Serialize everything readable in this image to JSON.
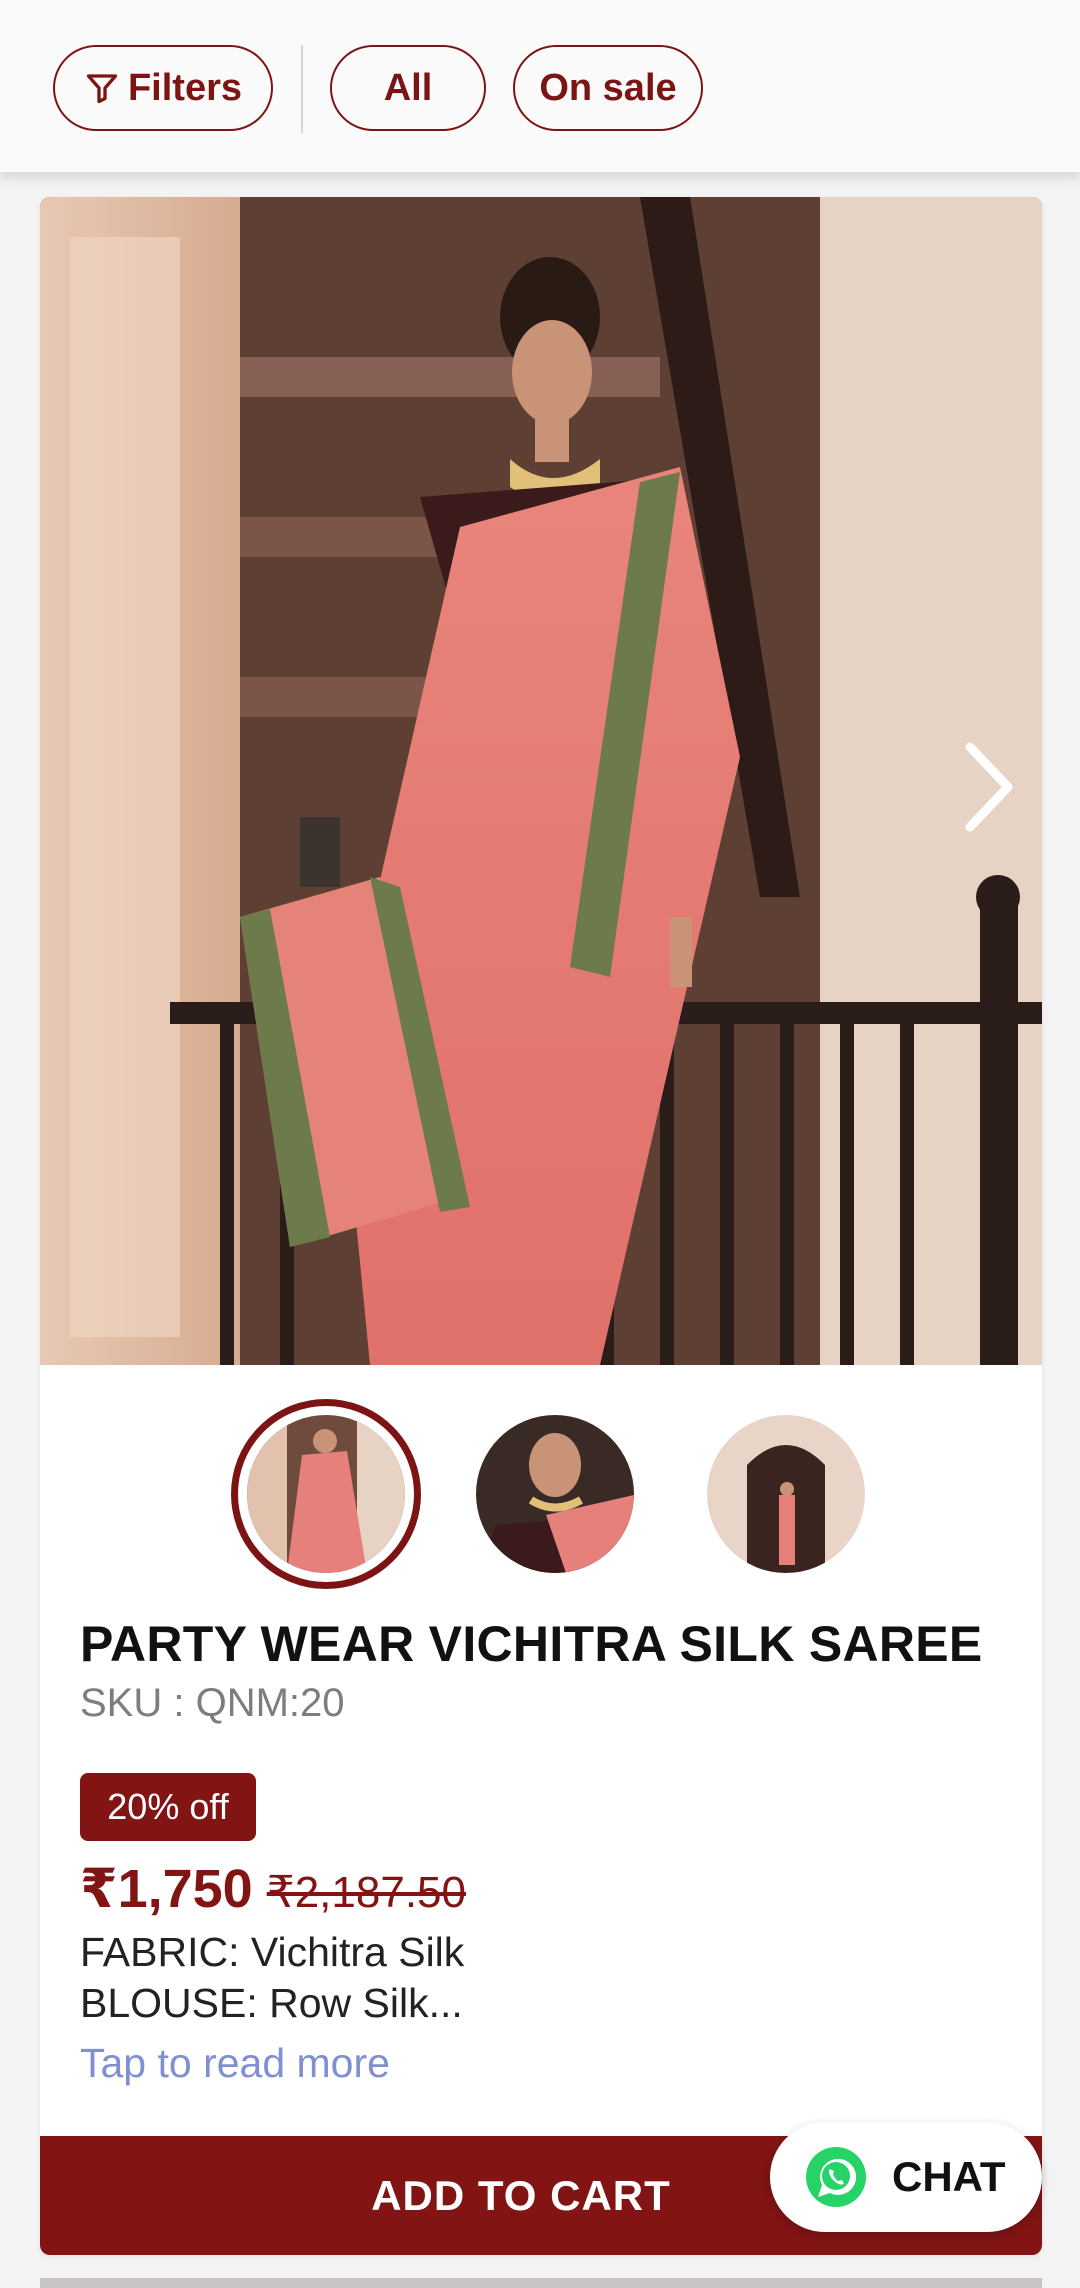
{
  "filters": {
    "filters_label": "Filters",
    "all_label": "All",
    "on_sale_label": "On sale"
  },
  "product": {
    "title": "PARTY WEAR VICHITRA SILK SAREE",
    "sku": "SKU : QNM:20",
    "discount_badge": "20% off",
    "price": "₹1,750",
    "old_price": "₹2,187.50",
    "description_line1": "FABRIC: Vichitra Silk",
    "description_line2": "BLOUSE: Row Silk...",
    "read_more": "Tap to read more",
    "add_to_cart": "ADD TO CART"
  },
  "chat": {
    "label": "CHAT"
  },
  "colors": {
    "brand": "#821414",
    "link": "#7f8fd2",
    "whatsapp": "#25d366"
  },
  "icons": [
    "filter-icon",
    "chevron-right-icon",
    "whatsapp-icon"
  ]
}
